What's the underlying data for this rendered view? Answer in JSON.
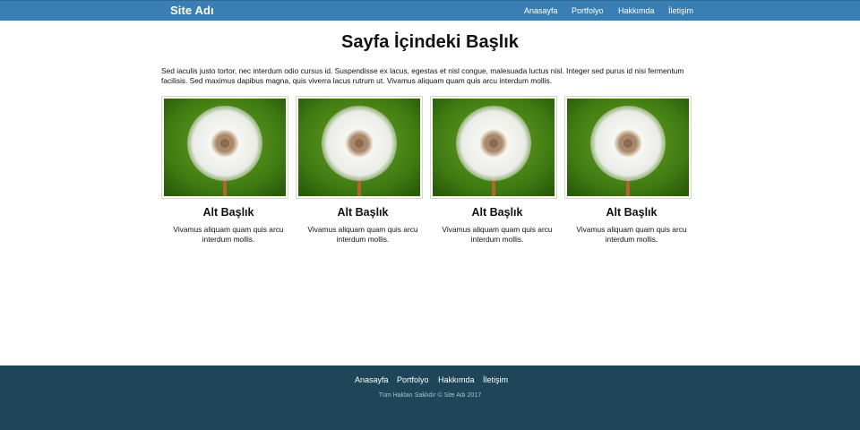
{
  "header": {
    "brand": "Site Adı",
    "nav": [
      "Anasayfa",
      "Portfolyo",
      "Hakkımda",
      "İletişim"
    ],
    "bg_color": "#3a7fb3"
  },
  "main": {
    "title": "Sayfa İçindeki Başlık",
    "intro": "Sed iaculis justo tortor, nec interdum odio cursus id. Suspendisse ex lacus, egestas et nisl congue, malesuada luctus nisl. Integer sed purus id nisi fermentum facilisis. Sed maximus dapibus magna, quis viverra lacus rutrum ut. Vivamus aliquam quam quis arcu interdum mollis.",
    "cards": [
      {
        "image": "dandelion-photo",
        "title": "Alt Başlık",
        "text": "Vivamus aliquam quam quis arcu interdum mollis."
      },
      {
        "image": "dandelion-photo",
        "title": "Alt Başlık",
        "text": "Vivamus aliquam quam quis arcu interdum mollis."
      },
      {
        "image": "dandelion-photo",
        "title": "Alt Başlık",
        "text": "Vivamus aliquam quam quis arcu interdum mollis."
      },
      {
        "image": "dandelion-photo",
        "title": "Alt Başlık",
        "text": "Vivamus aliquam quam quis arcu interdum mollis."
      }
    ]
  },
  "footer": {
    "nav": [
      "Anasayfa",
      "Portfolyo",
      "Hakkımda",
      "İletişim"
    ],
    "copyright": "Tüm Hakları Saklıdır © Site Adı 2017",
    "bg_color": "#1e4558"
  }
}
